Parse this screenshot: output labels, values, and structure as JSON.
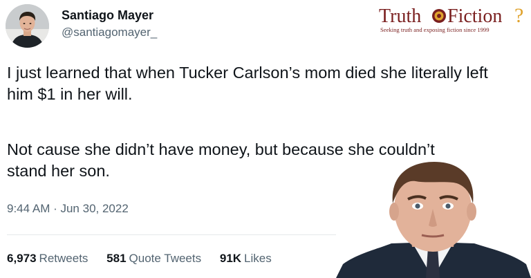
{
  "tweet": {
    "author": {
      "display_name": "Santiago Mayer",
      "handle": "@santiagomayer_"
    },
    "body": {
      "paragraph_1": "I just learned that when Tucker Carlson’s mom died she literally left him $1 in her will.",
      "paragraph_2": "Not cause she didn’t have money, but because she couldn’t stand her son."
    },
    "timestamp": "9:44 AM · Jun 30, 2022",
    "stats": [
      {
        "count": "6,973",
        "label": "Retweets"
      },
      {
        "count": "581",
        "label": "Quote Tweets"
      },
      {
        "count": "91K",
        "label": "Likes"
      }
    ]
  },
  "watermark": {
    "brand_left": "Truth",
    "brand_right": "Fiction",
    "tagline": "Seeking truth and exposing fiction since 1999",
    "brand_color": "#7a1f1f",
    "accent_color": "#e0a32e"
  },
  "colors": {
    "text_primary": "#0f1419",
    "text_secondary": "#536471",
    "divider": "#e6e8ea"
  }
}
